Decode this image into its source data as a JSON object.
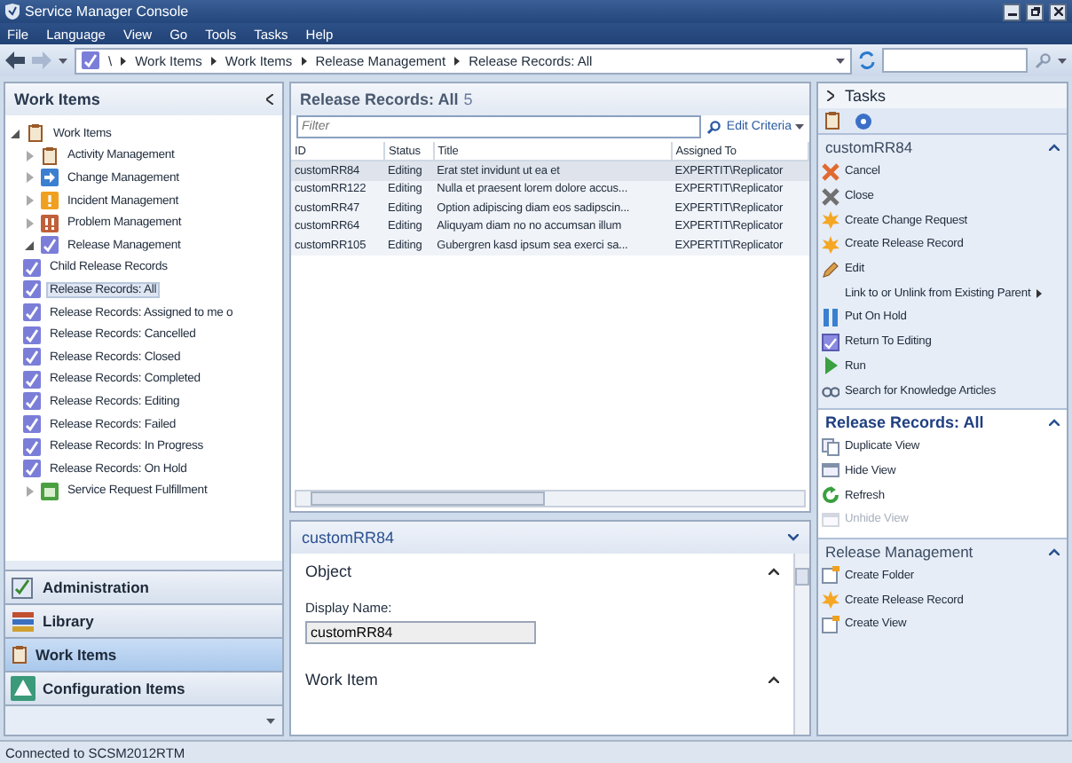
{
  "window": {
    "title": "Service Manager Console"
  },
  "menu": [
    "File",
    "Language",
    "View",
    "Go",
    "Tools",
    "Tasks",
    "Help"
  ],
  "breadcrumb": [
    "\\",
    "Work Items",
    "Work Items",
    "Release Management",
    "Release Records: All"
  ],
  "left_pane": {
    "title": "Work Items",
    "tree": [
      {
        "label": "Work Items",
        "kind": "workitems",
        "expanded": true,
        "selected": false,
        "children": [
          {
            "label": "Activity Management",
            "kind": "activity",
            "expanded": false,
            "selected": false
          },
          {
            "label": "Change Management",
            "kind": "change",
            "expanded": false,
            "selected": false
          },
          {
            "label": "Incident Management",
            "kind": "incident",
            "expanded": false,
            "selected": false
          },
          {
            "label": "Problem Management",
            "kind": "problem",
            "expanded": false,
            "selected": false
          },
          {
            "label": "Release Management",
            "kind": "release",
            "expanded": true,
            "selected": false,
            "children": [
              {
                "label": "Child Release Records",
                "kind": "release",
                "selected": false
              },
              {
                "label": "Release Records: All",
                "kind": "release",
                "selected": true
              },
              {
                "label": "Release Records: Assigned to me o",
                "kind": "release",
                "selected": false
              },
              {
                "label": "Release Records: Cancelled",
                "kind": "release",
                "selected": false
              },
              {
                "label": "Release Records: Closed",
                "kind": "release",
                "selected": false
              },
              {
                "label": "Release Records: Completed",
                "kind": "release",
                "selected": false
              },
              {
                "label": "Release Records: Editing",
                "kind": "release",
                "selected": false
              },
              {
                "label": "Release Records: Failed",
                "kind": "release",
                "selected": false
              },
              {
                "label": "Release Records: In Progress",
                "kind": "release",
                "selected": false
              },
              {
                "label": "Release Records: On Hold",
                "kind": "release",
                "selected": false
              }
            ]
          },
          {
            "label": "Service Request Fulfillment",
            "kind": "service",
            "expanded": false,
            "selected": false
          }
        ]
      }
    ],
    "nav": [
      {
        "label": "Administration",
        "kind": "admin",
        "selected": false
      },
      {
        "label": "Library",
        "kind": "library",
        "selected": false
      },
      {
        "label": "Work Items",
        "kind": "workitems",
        "selected": true
      },
      {
        "label": "Configuration Items",
        "kind": "config",
        "selected": false
      }
    ]
  },
  "list": {
    "title": "Release Records: All",
    "count": "5",
    "filter": {
      "placeholder": "Filter"
    },
    "edit_criteria": "Edit Criteria",
    "columns": [
      "ID",
      "Status",
      "Title",
      "Assigned To"
    ],
    "rows": [
      {
        "cells": [
          "customRR84",
          "Editing",
          "Erat stet invidunt ut ea et",
          "EXPERTIT\\Replicator"
        ],
        "selected": true
      },
      {
        "cells": [
          "customRR122",
          "Editing",
          "Nulla et praesent lorem dolore accus...",
          "EXPERTIT\\Replicator"
        ],
        "selected": false
      },
      {
        "cells": [
          "customRR47",
          "Editing",
          "Option adipiscing diam eos sadipscin...",
          "EXPERTIT\\Replicator"
        ],
        "selected": false
      },
      {
        "cells": [
          "customRR64",
          "Editing",
          "Aliquyam diam no no accumsan illum",
          "EXPERTIT\\Replicator"
        ],
        "selected": false
      },
      {
        "cells": [
          "customRR105",
          "Editing",
          "Gubergren kasd ipsum sea exerci sa...",
          "EXPERTIT\\Replicator"
        ],
        "selected": false
      }
    ]
  },
  "detail": {
    "title": "customRR84",
    "sections": [
      {
        "title": "Object",
        "expanded": true
      },
      {
        "title": "Work Item",
        "expanded": true
      }
    ],
    "field": {
      "label": "Display Name:",
      "value": "customRR84"
    }
  },
  "tasks": {
    "title": "Tasks",
    "sections": [
      {
        "title": "customRR84",
        "kind": "plain",
        "items": [
          {
            "label": "Cancel",
            "kind": "cancel",
            "disabled": false,
            "submenu": false
          },
          {
            "label": "Close",
            "kind": "close",
            "disabled": false,
            "submenu": false
          },
          {
            "label": "Create Change Request",
            "kind": "star",
            "disabled": false,
            "submenu": false
          },
          {
            "label": "Create Release Record",
            "kind": "star",
            "disabled": false,
            "submenu": false
          },
          {
            "label": "Edit",
            "kind": "edit",
            "disabled": false,
            "submenu": false
          },
          {
            "label": "Link to or Unlink from Existing Parent",
            "kind": "none",
            "disabled": false,
            "submenu": true
          },
          {
            "label": "Put On Hold",
            "kind": "pause",
            "disabled": false,
            "submenu": false
          },
          {
            "label": "Return To Editing",
            "kind": "return",
            "disabled": false,
            "submenu": false
          },
          {
            "label": "Run",
            "kind": "run",
            "disabled": false,
            "submenu": false
          },
          {
            "label": "Search for Knowledge Articles",
            "kind": "search",
            "disabled": false,
            "submenu": false
          }
        ]
      },
      {
        "title": "Release Records: All",
        "kind": "bold",
        "items": [
          {
            "label": "Duplicate View",
            "kind": "duplicate",
            "disabled": false,
            "submenu": false
          },
          {
            "label": "Hide View",
            "kind": "hide",
            "disabled": false,
            "submenu": false
          },
          {
            "label": "Refresh",
            "kind": "refresh",
            "disabled": false,
            "submenu": false
          },
          {
            "label": "Unhide View",
            "kind": "hide",
            "disabled": true,
            "submenu": false
          }
        ]
      },
      {
        "title": "Release Management",
        "kind": "plain",
        "items": [
          {
            "label": "Create Folder",
            "kind": "folder",
            "disabled": false,
            "submenu": false
          },
          {
            "label": "Create Release Record",
            "kind": "star",
            "disabled": false,
            "submenu": false
          },
          {
            "label": "Create View",
            "kind": "folder",
            "disabled": false,
            "submenu": false
          }
        ]
      }
    ]
  },
  "status_bar": "Connected to SCSM2012RTM"
}
